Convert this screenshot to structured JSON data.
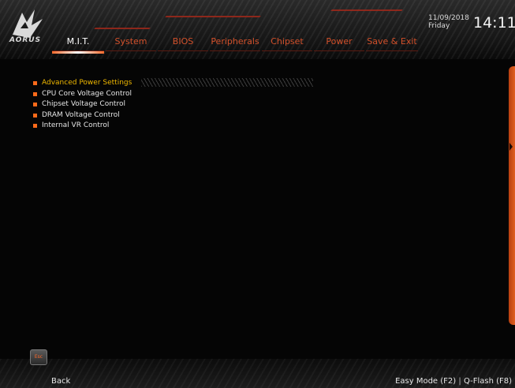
{
  "header": {
    "logo_text": "AORUS",
    "date": "11/09/2018",
    "day": "Friday",
    "time": "14:11",
    "tabs": [
      {
        "label": "M.I.T.",
        "active": true
      },
      {
        "label": "System",
        "active": false
      },
      {
        "label": "BIOS",
        "active": false
      },
      {
        "label": "Peripherals",
        "active": false
      },
      {
        "label": "Chipset",
        "active": false
      },
      {
        "label": "Power",
        "active": false
      },
      {
        "label": "Save & Exit",
        "active": false
      }
    ]
  },
  "menu": {
    "items": [
      {
        "label": "Advanced Power Settings",
        "selected": true
      },
      {
        "label": "CPU Core Voltage Control",
        "selected": false
      },
      {
        "label": "Chipset Voltage Control",
        "selected": false
      },
      {
        "label": "DRAM Voltage Control",
        "selected": false
      },
      {
        "label": "Internal VR Control",
        "selected": false
      }
    ]
  },
  "footer": {
    "esc_key": "Esc",
    "back_label": "Back",
    "easy_mode": "Easy Mode (F2)",
    "separator": "|",
    "qflash": "Q-Flash (F8)"
  },
  "colors": {
    "accent": "#ff6a1a",
    "tab_text": "#d2502a",
    "selected_text": "#f0b800",
    "background": "#050505"
  }
}
